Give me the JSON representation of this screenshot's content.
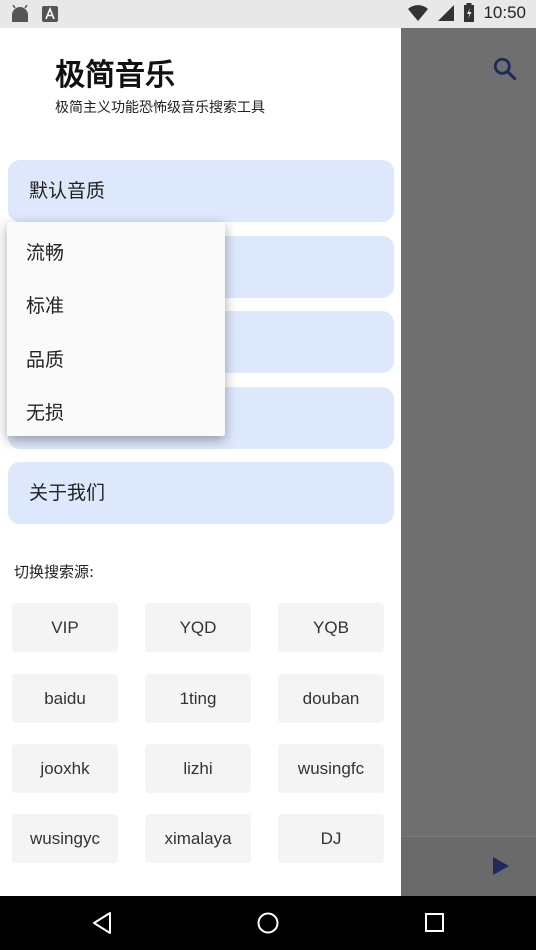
{
  "status_bar": {
    "time": "10:50",
    "notification_icons": [
      "android-icon",
      "a-badge-icon"
    ],
    "system_icons": [
      "wifi-icon",
      "signal-icon",
      "battery-icon"
    ]
  },
  "drawer": {
    "title": "极简音乐",
    "subtitle": "极简主义功能恐怖级音乐搜索工具",
    "menu": {
      "quality_label": "默认音质",
      "about_label": "关于我们"
    },
    "quality_dropdown": {
      "options": [
        "流畅",
        "标准",
        "品质",
        "无损"
      ]
    },
    "source_section_label": "切换搜索源:",
    "sources": [
      "VIP",
      "YQD",
      "YQB",
      "baidu",
      "1ting",
      "douban",
      "jooxhk",
      "lizhi",
      "wusingfc",
      "wusingyc",
      "ximalaya",
      "DJ"
    ]
  },
  "colors": {
    "menu_bg": "#dde8fd",
    "source_bg": "#f4f4f4",
    "scrim": "#6b6b6b",
    "accent_icon": "#1f2a5a"
  },
  "nav_bar": {
    "icons": [
      "back-icon",
      "home-icon",
      "recents-icon"
    ]
  }
}
